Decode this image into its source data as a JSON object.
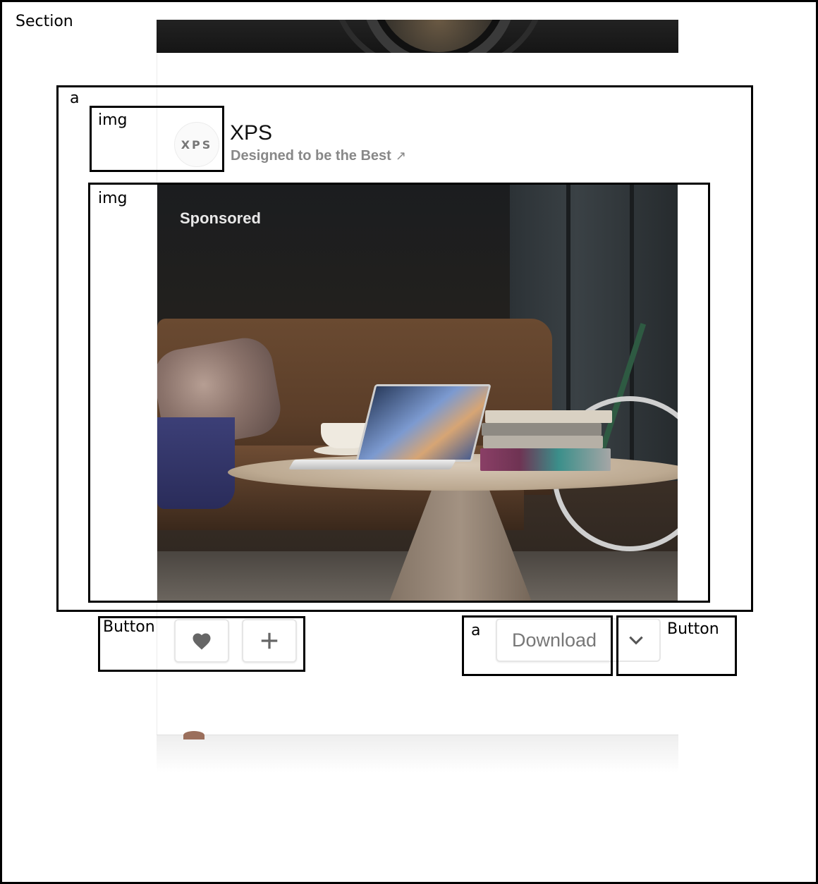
{
  "annotations": {
    "section_label": "Section",
    "link_label": "a",
    "logo_img_label": "img",
    "hero_img_label": "img",
    "action_buttons_label": "Button",
    "download_link_label": "a",
    "dropdown_button_label": "Button"
  },
  "ad": {
    "logo_text": "XPS",
    "brand_title": "XPS",
    "tagline": "Designed to be the Best",
    "tagline_arrow": "↗",
    "sponsored_label": "Sponsored"
  },
  "actions": {
    "like_icon": "heart-icon",
    "add_icon": "plus-icon",
    "download_label": "Download",
    "dropdown_icon": "chevron-down-icon"
  }
}
